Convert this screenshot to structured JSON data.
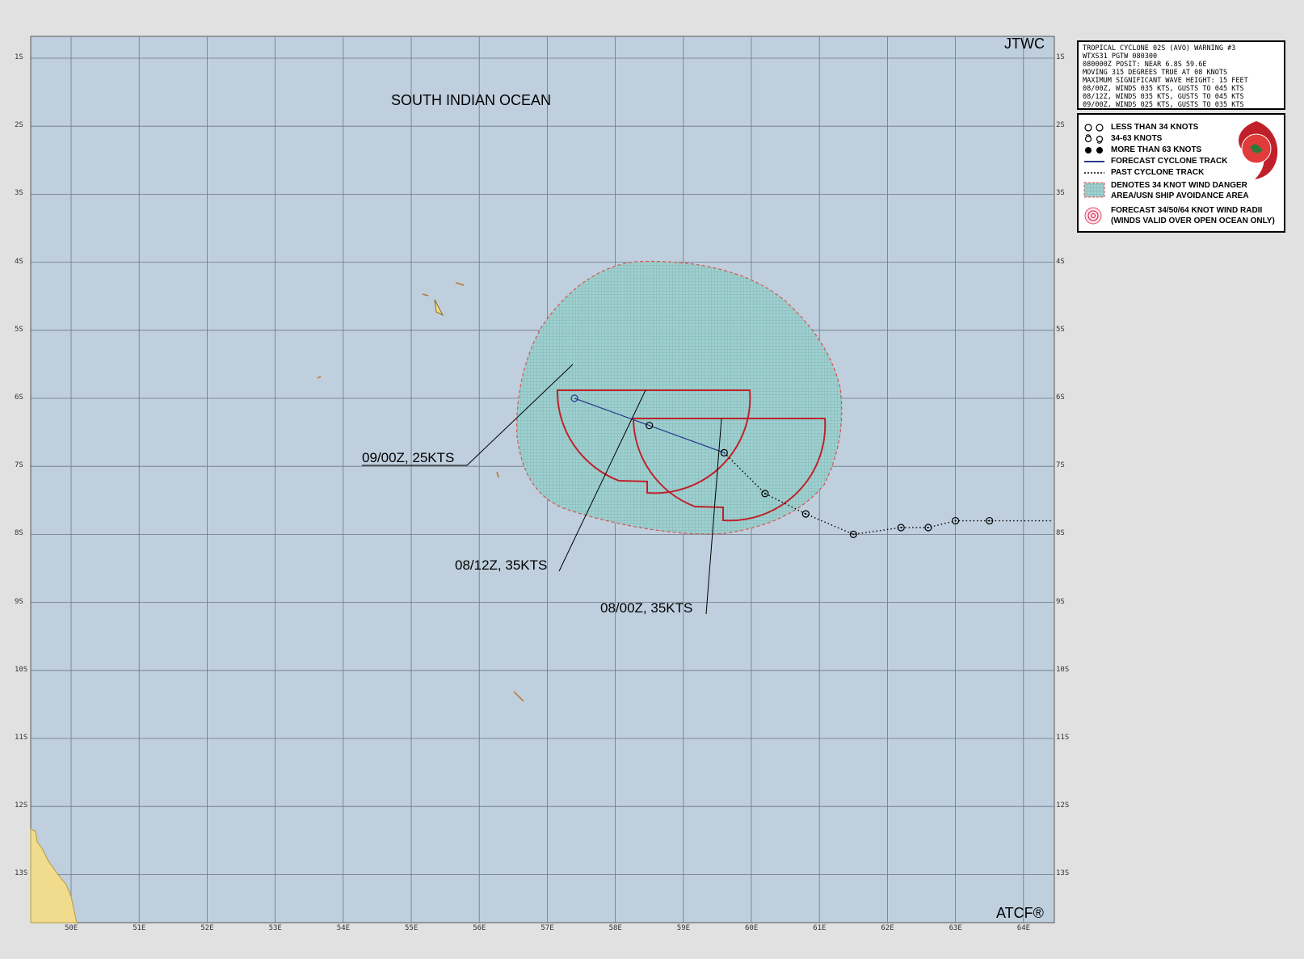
{
  "map": {
    "region_label": "SOUTH INDIAN OCEAN",
    "agency": "JTWC",
    "software": "ATCF®",
    "lat_labels": [
      "1S",
      "2S",
      "3S",
      "4S",
      "5S",
      "6S",
      "7S",
      "8S",
      "9S",
      "10S",
      "11S",
      "12S",
      "13S"
    ],
    "lon_labels": [
      "50E",
      "51E",
      "52E",
      "53E",
      "54E",
      "55E",
      "56E",
      "57E",
      "58E",
      "59E",
      "60E",
      "61E",
      "62E",
      "63E",
      "64E"
    ],
    "colors": {
      "ocean": "#bfcfde",
      "land": "#f0dc8c",
      "grid": "#6b7784",
      "danger": "#8cc7c7",
      "danger_border": "#d9534f",
      "radii": "#c0202a",
      "track": "#2b3a8c"
    }
  },
  "track": {
    "forecast_points": [
      {
        "label": "08/00Z,  35KTS",
        "lon": 59.6,
        "lat": -6.8
      },
      {
        "label": "08/12Z,  35KTS",
        "lon": 58.5,
        "lat": -6.4
      },
      {
        "label": "09/00Z,  25KTS",
        "lon": 57.4,
        "lat": -6.0
      }
    ],
    "past_points": [
      {
        "lon": 60.2,
        "lat": -7.4
      },
      {
        "lon": 60.8,
        "lat": -7.7
      },
      {
        "lon": 61.5,
        "lat": -8.0
      },
      {
        "lon": 62.2,
        "lat": -7.9
      },
      {
        "lon": 62.6,
        "lat": -7.9
      },
      {
        "lon": 63.0,
        "lat": -7.8
      },
      {
        "lon": 63.5,
        "lat": -7.8
      }
    ]
  },
  "warning": {
    "lines": [
      "TROPICAL CYCLONE 02S (AVO) WARNING #3",
      "WTXS31 PGTW 080300",
      "080000Z POSIT: NEAR 6.8S 59.6E",
      "MOVING 315 DEGREES TRUE AT 08 KNOTS",
      "MAXIMUM SIGNIFICANT WAVE HEIGHT: 15 FEET",
      "08/00Z, WINDS 035 KTS, GUSTS TO 045 KTS",
      "08/12Z, WINDS 035 KTS, GUSTS TO 045 KTS",
      "09/00Z, WINDS 025 KTS, GUSTS TO 035 KTS"
    ]
  },
  "legend": {
    "items": [
      {
        "symbol": "circle-icon",
        "text": "LESS THAN 34 KNOTS"
      },
      {
        "symbol": "storm-open-icon",
        "text": "34-63 KNOTS"
      },
      {
        "symbol": "storm-filled-icon",
        "text": "MORE THAN 63 KNOTS"
      },
      {
        "symbol": "solid-line-icon",
        "text": "FORECAST CYCLONE TRACK"
      },
      {
        "symbol": "dotted-line-icon",
        "text": "PAST CYCLONE TRACK"
      },
      {
        "symbol": "hatched-area-icon",
        "text": "DENOTES 34 KNOT WIND DANGER"
      },
      {
        "symbol": "",
        "text": "AREA/USN SHIP AVOIDANCE AREA"
      },
      {
        "symbol": "wind-radii-icon",
        "text": "FORECAST 34/50/64 KNOT WIND RADII"
      },
      {
        "symbol": "",
        "text": "(WINDS VALID OVER OPEN OCEAN ONLY)"
      }
    ]
  }
}
